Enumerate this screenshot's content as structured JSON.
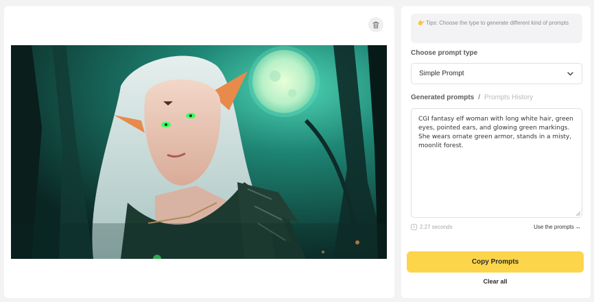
{
  "tips": {
    "icon": "pointing-hand-icon",
    "text": "Tips: Choose the type to generate different kind of prompts"
  },
  "prompt_type": {
    "label": "Choose prompt type",
    "selected": "Simple Prompt"
  },
  "tabs": {
    "generated": "Generated prompts",
    "separator": "/",
    "history": "Prompts History"
  },
  "generated_prompt": "CGI fantasy elf woman with long white hair, green eyes, pointed ears, and glowing green markings. She wears ornate green armor, stands in a misty, moonlit forest.",
  "meta": {
    "time": "2.27 seconds",
    "use_link": "Use the prompts ↔"
  },
  "actions": {
    "copy": "Copy Prompts",
    "clear": "Clear all"
  },
  "colors": {
    "accent": "#fdd54a",
    "image_glow": "#3fbfa4"
  }
}
